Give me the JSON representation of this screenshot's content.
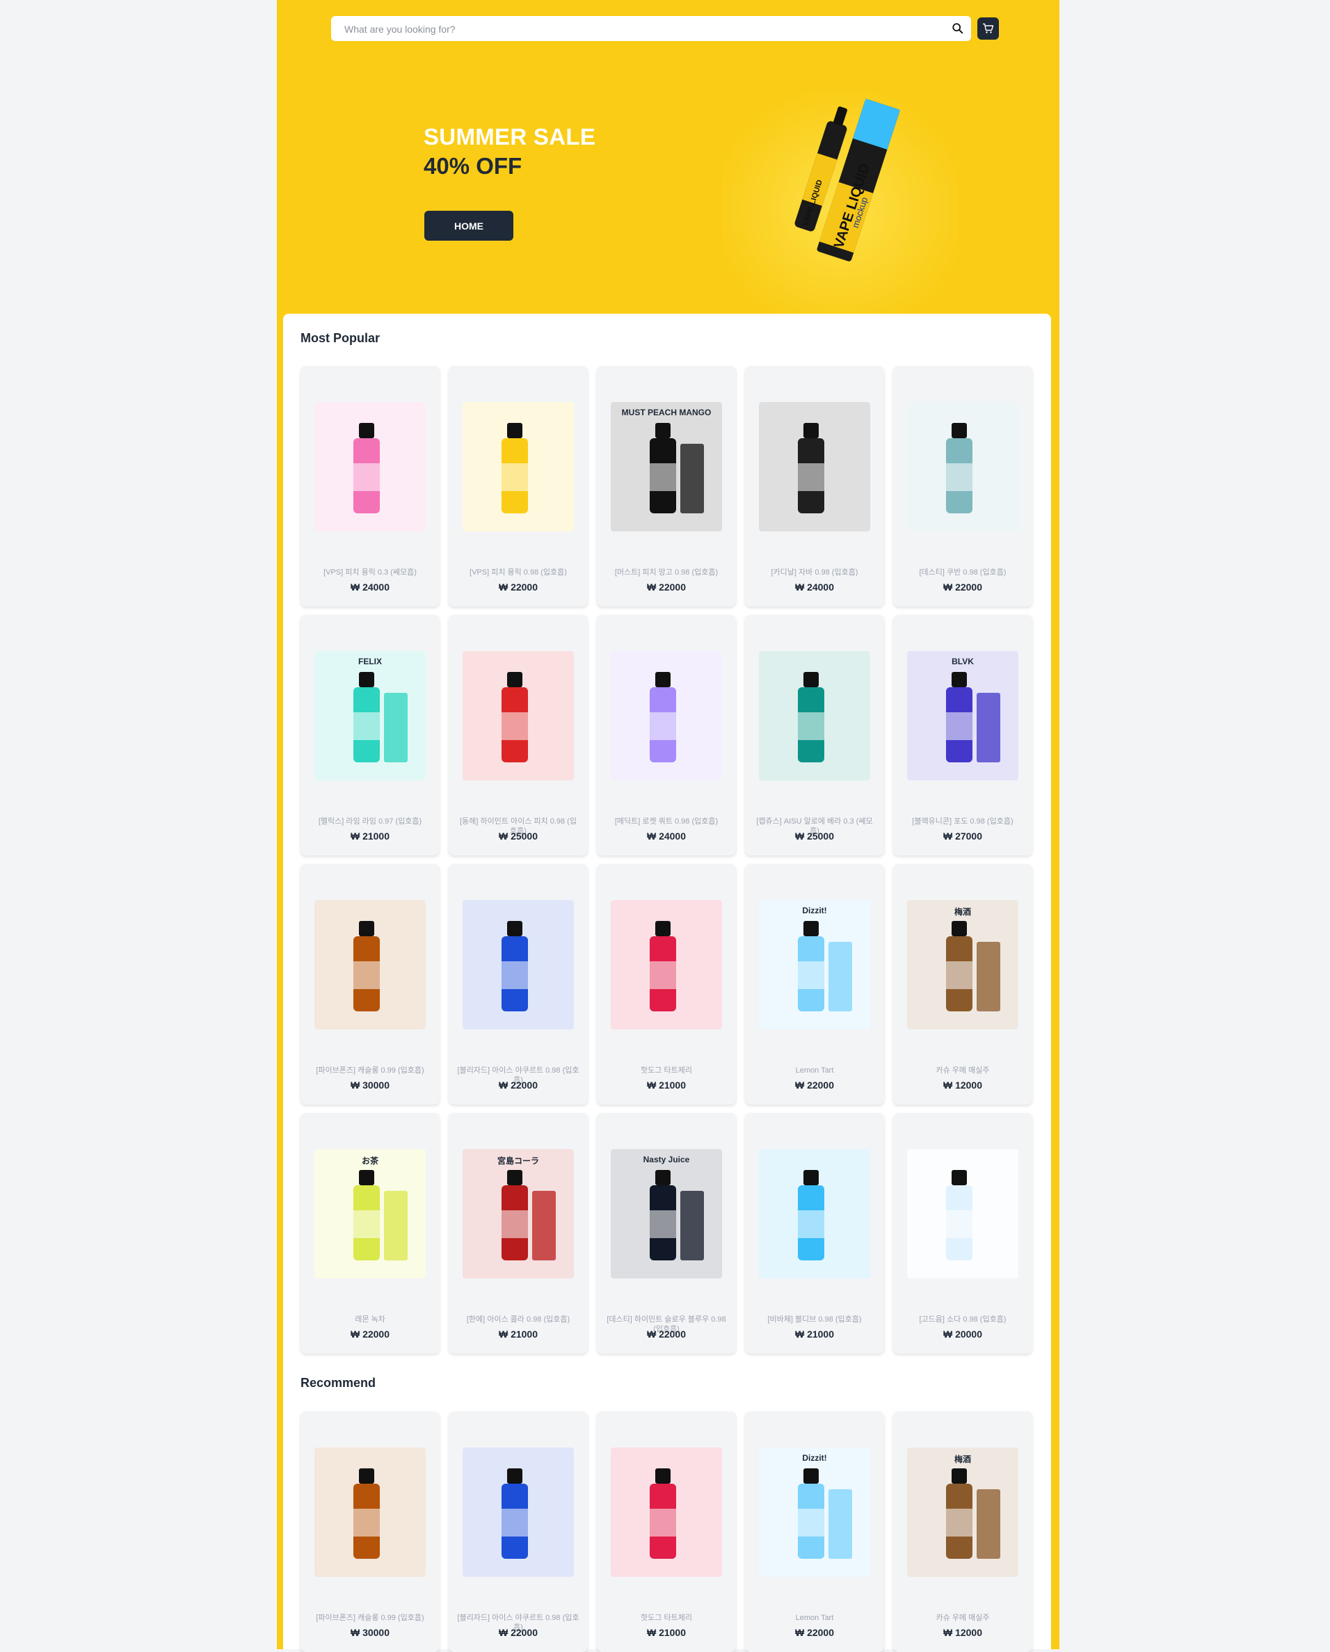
{
  "search": {
    "placeholder": "What are you looking for?"
  },
  "icons": {
    "search": "search-icon",
    "cart": "cart-icon"
  },
  "hero": {
    "title": "SUMMER SALE",
    "discount": "40% OFF",
    "button_label": "HOME",
    "image_text": [
      "VAPE LIQUID",
      "mockup"
    ]
  },
  "colors": {
    "brand": "#facc15",
    "dark": "#1f2937",
    "muted": "#9ca3af"
  },
  "sections": {
    "popular": {
      "title": "Most Popular",
      "items": [
        {
          "name": "[VPS] 피치 용릭 0.3 (쎄모흡)",
          "price": "₩ 24000",
          "theme": "#f472b6"
        },
        {
          "name": "[VPS] 피치 용릭 0.98 (입호흡)",
          "price": "₩ 22000",
          "theme": "#facc15"
        },
        {
          "name": "[머스트] 피치 망고 0.98 (입호흡)",
          "price": "₩ 22000",
          "theme": "#111111",
          "label": "MUST PEACH MANGO"
        },
        {
          "name": "[카디날] 자바 0.98 (입호흡)",
          "price": "₩ 24000",
          "theme": "#1f1f1f"
        },
        {
          "name": "[데스티] 쿠반 0.98 (입호흡)",
          "price": "₩ 22000",
          "theme": "#7fb8bf"
        },
        {
          "name": "[펠릭스] 라임 라임 0.97 (입호흡)",
          "price": "₩ 21000",
          "theme": "#2dd4bf",
          "label": "FELIX"
        },
        {
          "name": "[동해] 하이민트 아이스 피치 0.98 (입호흡)",
          "price": "₩ 25000",
          "theme": "#dc2626"
        },
        {
          "name": "[메딕트] 로켓 쿼트 0.98 (입호흡)",
          "price": "₩ 24000",
          "theme": "#a78bfa"
        },
        {
          "name": "[캡쥬스] AISU 알로에 베라 0.3 (쎄모흡)",
          "price": "₩ 25000",
          "theme": "#0d9488"
        },
        {
          "name": "[블랙유니콘] 포도 0.98 (입호흡)",
          "price": "₩ 27000",
          "theme": "#4338ca",
          "label": "BLVK"
        },
        {
          "name": "[파이브폰즈] 캐슬롱 0.99 (입호흡)",
          "price": "₩ 30000",
          "theme": "#b45309"
        },
        {
          "name": "[블리자드] 아이스 야쿠르트 0.98 (입호흡)",
          "price": "₩ 22000",
          "theme": "#1d4ed8"
        },
        {
          "name": "핫도그 타트체리",
          "price": "₩ 21000",
          "theme": "#e11d48"
        },
        {
          "name": "Lemon Tart",
          "price": "₩ 22000",
          "theme": "#7dd3fc",
          "label": "Dizzit!"
        },
        {
          "name": "카슈 우메 매실주",
          "price": "₩ 12000",
          "theme": "#8b5a2b",
          "label": "梅酒"
        },
        {
          "name": "레몬 녹차",
          "price": "₩ 22000",
          "theme": "#d9e84a",
          "label": "お茶"
        },
        {
          "name": "[한에] 아이스 콜라 0.98 (입호흡)",
          "price": "₩ 21000",
          "theme": "#b91c1c",
          "label": "宮島コーラ"
        },
        {
          "name": "[데스티] 하이민트 슬로우 블루우 0.98 (입호흡)",
          "price": "₩ 22000",
          "theme": "#111827",
          "label": "Nasty Juice"
        },
        {
          "name": "[비바체] 블디브 0.98 (입호흡)",
          "price": "₩ 21000",
          "theme": "#38bdf8"
        },
        {
          "name": "[고드음] 소다 0.98 (입호흡)",
          "price": "₩ 20000",
          "theme": "#e0f2fe"
        }
      ]
    },
    "recommend": {
      "title": "Recommend",
      "items": [
        {
          "name": "[파이브폰즈] 캐슬롱 0.99 (입호흡)",
          "price": "₩ 30000",
          "theme": "#b45309"
        },
        {
          "name": "[블리자드] 아이스 야쿠르트 0.98 (입호흡)",
          "price": "₩ 22000",
          "theme": "#1d4ed8"
        },
        {
          "name": "핫도그 타트체리",
          "price": "₩ 21000",
          "theme": "#e11d48"
        },
        {
          "name": "Lemon Tart",
          "price": "₩ 22000",
          "theme": "#7dd3fc",
          "label": "Dizzit!"
        },
        {
          "name": "카슈 우메 매실주",
          "price": "₩ 12000",
          "theme": "#8b5a2b",
          "label": "梅酒"
        }
      ]
    }
  }
}
